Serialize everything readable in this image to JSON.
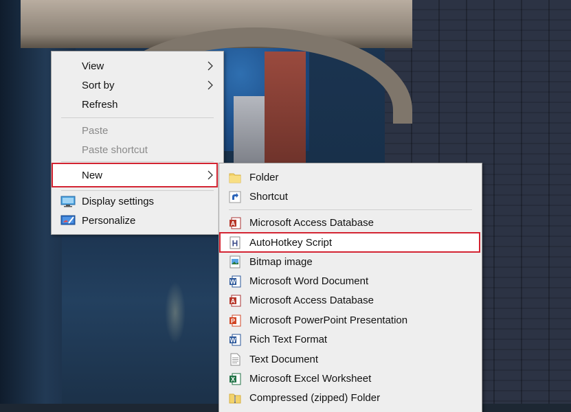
{
  "main_menu": {
    "items": [
      {
        "label": "View",
        "has_submenu": true,
        "enabled": true
      },
      {
        "label": "Sort by",
        "has_submenu": true,
        "enabled": true
      },
      {
        "label": "Refresh",
        "has_submenu": false,
        "enabled": true
      },
      {
        "label": "Paste",
        "has_submenu": false,
        "enabled": false
      },
      {
        "label": "Paste shortcut",
        "has_submenu": false,
        "enabled": false
      },
      {
        "label": "New",
        "has_submenu": true,
        "enabled": true,
        "highlighted": true
      },
      {
        "label": "Display settings",
        "icon": "display-settings-icon",
        "enabled": true
      },
      {
        "label": "Personalize",
        "icon": "personalize-icon",
        "enabled": true
      }
    ]
  },
  "new_submenu": {
    "items": [
      {
        "label": "Folder",
        "icon": "folder-icon"
      },
      {
        "label": "Shortcut",
        "icon": "shortcut-icon"
      },
      {
        "label": "Microsoft Access Database",
        "icon": "access-icon"
      },
      {
        "label": "AutoHotkey Script",
        "icon": "autohotkey-icon",
        "highlighted": true
      },
      {
        "label": "Bitmap image",
        "icon": "bitmap-icon"
      },
      {
        "label": "Microsoft Word Document",
        "icon": "word-icon"
      },
      {
        "label": "Microsoft Access Database",
        "icon": "access-icon"
      },
      {
        "label": "Microsoft PowerPoint Presentation",
        "icon": "powerpoint-icon"
      },
      {
        "label": "Rich Text Format",
        "icon": "rtf-icon"
      },
      {
        "label": "Text Document",
        "icon": "text-document-icon"
      },
      {
        "label": "Microsoft Excel Worksheet",
        "icon": "excel-icon"
      },
      {
        "label": "Compressed (zipped) Folder",
        "icon": "zip-folder-icon"
      }
    ]
  },
  "colors": {
    "menu_bg": "#eeeeee",
    "highlight_border": "#d32331",
    "disabled_text": "#8a8a8a"
  }
}
